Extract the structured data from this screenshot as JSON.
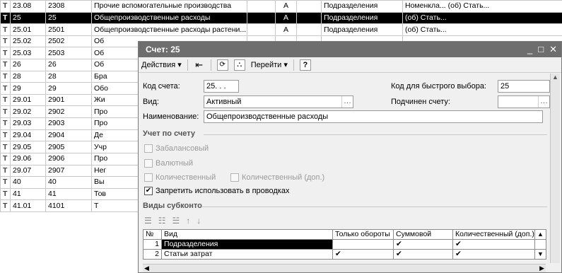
{
  "table": {
    "rows": [
      {
        "icon": "Т",
        "code": "23.08",
        "code2": "2308",
        "name": "Прочие вспомогательные производства",
        "type": "А",
        "sub": "Подразделения",
        "sub2": "Номенкла... (об) Стать...",
        "selected": false
      },
      {
        "icon": "Т",
        "code": "25",
        "code2": "25",
        "name": "Общепроизводственные расходы",
        "type": "А",
        "sub": "Подразделения",
        "sub2": "(об) Стать...",
        "selected": true
      },
      {
        "icon": "Т",
        "code": "25.01",
        "code2": "2501",
        "name": "Общепроизводственные расходы растени...",
        "type": "А",
        "sub": "Подразделения",
        "sub2": "(об) Стать...",
        "selected": false
      },
      {
        "icon": "Т",
        "code": "25.02",
        "code2": "2502",
        "name": "Об",
        "type": "",
        "sub": "",
        "sub2": "",
        "selected": false
      },
      {
        "icon": "Т",
        "code": "25.03",
        "code2": "2503",
        "name": "Об",
        "type": "",
        "sub": "",
        "sub2": "",
        "selected": false
      },
      {
        "icon": "Т",
        "code": "26",
        "code2": "26",
        "name": "Об",
        "type": "",
        "sub": "",
        "sub2": "",
        "selected": false
      },
      {
        "icon": "Т",
        "code": "28",
        "code2": "28",
        "name": "Бра",
        "type": "",
        "sub": "",
        "sub2": "",
        "selected": false
      },
      {
        "icon": "Т",
        "code": "29",
        "code2": "29",
        "name": "Обо",
        "type": "",
        "sub": "",
        "sub2": "",
        "selected": false
      },
      {
        "icon": "Т",
        "code": "29.01",
        "code2": "2901",
        "name": "Жи",
        "type": "",
        "sub": "",
        "sub2": "",
        "selected": false
      },
      {
        "icon": "Т",
        "code": "29.02",
        "code2": "2902",
        "name": "Про",
        "type": "",
        "sub": "",
        "sub2": "",
        "selected": false
      },
      {
        "icon": "Т",
        "code": "29.03",
        "code2": "2903",
        "name": "Про",
        "type": "",
        "sub": "",
        "sub2": "",
        "selected": false
      },
      {
        "icon": "Т",
        "code": "29.04",
        "code2": "2904",
        "name": "Де",
        "type": "",
        "sub": "",
        "sub2": "",
        "selected": false
      },
      {
        "icon": "Т",
        "code": "29.05",
        "code2": "2905",
        "name": "Учр",
        "type": "",
        "sub": "",
        "sub2": "",
        "selected": false
      },
      {
        "icon": "Т",
        "code": "29.06",
        "code2": "2906",
        "name": "Про",
        "type": "",
        "sub": "",
        "sub2": "",
        "selected": false
      },
      {
        "icon": "Т",
        "code": "29.07",
        "code2": "2907",
        "name": "Нег",
        "type": "",
        "sub": "",
        "sub2": "",
        "selected": false
      },
      {
        "icon": "Т",
        "code": "40",
        "code2": "40",
        "name": "Вы",
        "type": "",
        "sub": "",
        "sub2": "",
        "selected": false
      },
      {
        "icon": "Т",
        "code": "41",
        "code2": "41",
        "name": "Тов",
        "type": "",
        "sub": "",
        "sub2": "",
        "selected": false
      },
      {
        "icon": "Т",
        "code": "41.01",
        "code2": "4101",
        "name": "Т",
        "type": "",
        "sub": "",
        "sub2": "",
        "selected": false
      }
    ]
  },
  "dialog": {
    "title": "Счет: 25",
    "toolbar": {
      "actions": "Действия",
      "goto": "Перейти",
      "help": "?"
    },
    "fields": {
      "code_label": "Код счета:",
      "code_value": "25. . .",
      "quick_code_label": "Код для быстрого выбора:",
      "quick_code_value": "25",
      "kind_label": "Вид:",
      "kind_value": "Активный",
      "parent_label": "Подчинен счету:",
      "parent_value": "",
      "name_label": "Наименование:",
      "name_value": "Общепроизводственные расходы"
    },
    "accounting": {
      "title": "Учет по счету",
      "offbalance": "Забалансовый",
      "currency": "Валютный",
      "quantity": "Количественный",
      "quantity_extra": "Количественный (доп.)",
      "forbid": "Запретить использовать в проводках"
    },
    "subconto": {
      "title": "Виды субконто",
      "headers": [
        "№",
        "Вид",
        "Только обороты",
        "Суммовой",
        "Количественный (доп.)"
      ],
      "rows": [
        {
          "num": "1",
          "name": "Подразделения",
          "turnover": "",
          "sum": "✔",
          "qty": "✔"
        },
        {
          "num": "2",
          "name": "Статьи затрат",
          "turnover": "✔",
          "sum": "✔",
          "qty": "✔"
        }
      ]
    }
  }
}
